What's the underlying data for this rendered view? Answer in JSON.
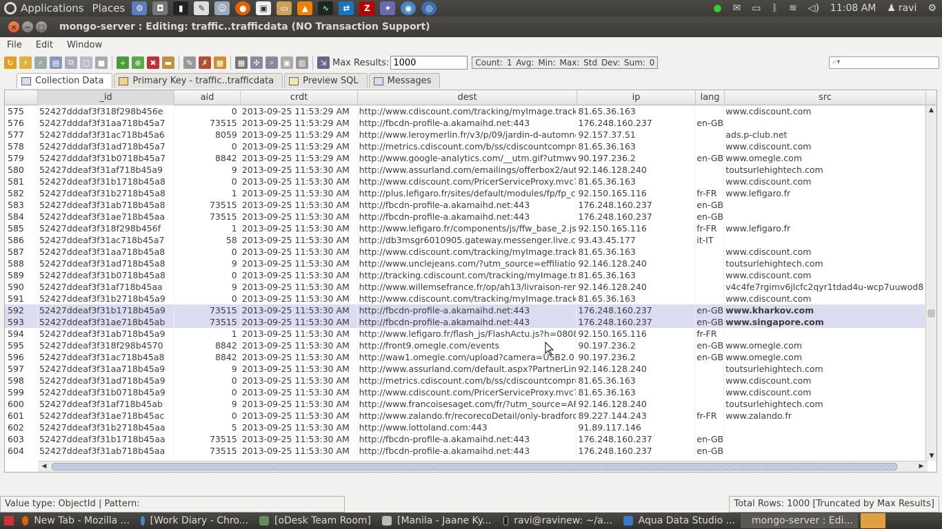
{
  "top_panel": {
    "applications": "Applications",
    "places": "Places",
    "clock": "11:08 AM",
    "user": "ravi"
  },
  "window": {
    "title": "mongo-server : Editing: traffic..trafficdata (NO Transaction Support)"
  },
  "menu": {
    "file": "File",
    "edit": "Edit",
    "window": "Window"
  },
  "toolbar": {
    "max_results_label": "Max Results:",
    "max_results_value": "1000",
    "stats": "Count: 1   Avg:   Min:   Max:   Std Dev:   Sum: 0"
  },
  "tabs": [
    {
      "label": "Collection Data"
    },
    {
      "label": "Primary Key - traffic..trafficdata"
    },
    {
      "label": "Preview SQL"
    },
    {
      "label": "Messages"
    }
  ],
  "grid": {
    "columns": [
      "_id",
      "aid",
      "crdt",
      "dest",
      "ip",
      "lang",
      "src"
    ],
    "rows": [
      {
        "n": "575",
        "id": "52427dddaf3f318f298b456e",
        "aid": "0",
        "crdt": "2013-09-25 11:53:29 AM",
        "dest": "http://www.cdiscount.com/tracking/myImage.track_",
        "ip": "81.65.36.163",
        "lang": "",
        "src": "www.cdiscount.com"
      },
      {
        "n": "576",
        "id": "52427dddaf3f31aa718b45a7",
        "aid": "73515",
        "crdt": "2013-09-25 11:53:29 AM",
        "dest": "http://fbcdn-profile-a.akamaihd.net:443",
        "ip": "176.248.160.237",
        "lang": "en-GB",
        "src": ""
      },
      {
        "n": "577",
        "id": "52427dddaf3f31ac718b45a6",
        "aid": "8059",
        "crdt": "2013-09-25 11:53:29 AM",
        "dest": "http://www.leroymerlin.fr/v3/p/09/jardin-d-automne-",
        "ip": "92.157.37.51",
        "lang": "",
        "src": "ads.p-club.net"
      },
      {
        "n": "578",
        "id": "52427dddaf3f31ad718b45a7",
        "aid": "0",
        "crdt": "2013-09-25 11:53:29 AM",
        "dest": "http://metrics.cdiscount.com/b/ss/cdiscountcompro",
        "ip": "81.65.36.163",
        "lang": "",
        "src": "www.cdiscount.com"
      },
      {
        "n": "579",
        "id": "52427dddaf3f31b0718b45a7",
        "aid": "8842",
        "crdt": "2013-09-25 11:53:29 AM",
        "dest": "http://www.google-analytics.com/__utm.gif?utmwv=",
        "ip": "90.197.236.2",
        "lang": "en-GB",
        "src": "www.omegle.com"
      },
      {
        "n": "580",
        "id": "52427ddeaf3f31af718b45a9",
        "aid": "9",
        "crdt": "2013-09-25 11:53:30 AM",
        "dest": "http://www.assurland.com/emailings/offerbox2/autos",
        "ip": "92.146.128.240",
        "lang": "",
        "src": "toutsurlehightech.com"
      },
      {
        "n": "581",
        "id": "52427ddeaf3f31b1718b45a8",
        "aid": "0",
        "crdt": "2013-09-25 11:53:30 AM",
        "dest": "http://www.cdiscount.com/PricerServiceProxy.mvc?p",
        "ip": "81.65.36.163",
        "lang": "",
        "src": "www.cdiscount.com"
      },
      {
        "n": "582",
        "id": "52427ddeaf3f31b2718b45a8",
        "aid": "1",
        "crdt": "2013-09-25 11:53:30 AM",
        "dest": "http://plus.lefigaro.fr/sites/default/modules/fp/fp_co",
        "ip": "92.150.165.116",
        "lang": "fr-FR",
        "src": "www.lefigaro.fr"
      },
      {
        "n": "583",
        "id": "52427ddeaf3f31ab718b45a8",
        "aid": "73515",
        "crdt": "2013-09-25 11:53:30 AM",
        "dest": "http://fbcdn-profile-a.akamaihd.net:443",
        "ip": "176.248.160.237",
        "lang": "en-GB",
        "src": ""
      },
      {
        "n": "584",
        "id": "52427ddeaf3f31ae718b45aa",
        "aid": "73515",
        "crdt": "2013-09-25 11:53:30 AM",
        "dest": "http://fbcdn-profile-a.akamaihd.net:443",
        "ip": "176.248.160.237",
        "lang": "en-GB",
        "src": ""
      },
      {
        "n": "585",
        "id": "52427ddeaf3f318f298b456f",
        "aid": "1",
        "crdt": "2013-09-25 11:53:30 AM",
        "dest": "http://www.lefigaro.fr/components/js/ffw_base_2.js?",
        "ip": "92.150.165.116",
        "lang": "fr-FR",
        "src": "www.lefigaro.fr"
      },
      {
        "n": "586",
        "id": "52427ddeaf3f31ac718b45a7",
        "aid": "58",
        "crdt": "2013-09-25 11:53:30 AM",
        "dest": "http://db3msgr6010905.gateway.messenger.live.co",
        "ip": "93.43.45.177",
        "lang": "it-IT",
        "src": ""
      },
      {
        "n": "587",
        "id": "52427ddeaf3f31aa718b45a8",
        "aid": "0",
        "crdt": "2013-09-25 11:53:30 AM",
        "dest": "http://www.cdiscount.com/tracking/myImage.track_",
        "ip": "81.65.36.163",
        "lang": "",
        "src": "www.cdiscount.com"
      },
      {
        "n": "588",
        "id": "52427ddeaf3f31ad718b45a8",
        "aid": "9",
        "crdt": "2013-09-25 11:53:30 AM",
        "dest": "http://www.unclejeans.com/?utm_source=effiliation",
        "ip": "92.146.128.240",
        "lang": "",
        "src": "toutsurlehightech.com"
      },
      {
        "n": "589",
        "id": "52427ddeaf3f31b0718b45a8",
        "aid": "0",
        "crdt": "2013-09-25 11:53:30 AM",
        "dest": "http://tracking.cdiscount.com/tracking/myImage.tra",
        "ip": "81.65.36.163",
        "lang": "",
        "src": "www.cdiscount.com"
      },
      {
        "n": "590",
        "id": "52427ddeaf3f31af718b45aa",
        "aid": "9",
        "crdt": "2013-09-25 11:53:30 AM",
        "dest": "http://www.willemsefrance.fr/op/ah13/livraison-remi",
        "ip": "92.146.128.240",
        "lang": "",
        "src": "v4c4fe7rgimv6jlcfc2qyr1tdad4u-wcp7uuwod8"
      },
      {
        "n": "591",
        "id": "52427ddeaf3f31b2718b45a9",
        "aid": "0",
        "crdt": "2013-09-25 11:53:30 AM",
        "dest": "http://www.cdiscount.com/tracking/myImage.track_",
        "ip": "81.65.36.163",
        "lang": "",
        "src": "www.cdiscount.com"
      },
      {
        "n": "592",
        "id": "52427ddeaf3f31b1718b45a9",
        "aid": "73515",
        "crdt": "2013-09-25 11:53:30 AM",
        "dest": "http://fbcdn-profile-a.akamaihd.net:443",
        "ip": "176.248.160.237",
        "lang": "en-GB",
        "src": "www.kharkov.com"
      },
      {
        "n": "593",
        "id": "52427ddeaf3f31ae718b45ab",
        "aid": "73515",
        "crdt": "2013-09-25 11:53:30 AM",
        "dest": "http://fbcdn-profile-a.akamaihd.net:443",
        "ip": "176.248.160.237",
        "lang": "en-GB",
        "src": "www.singapore.com"
      },
      {
        "n": "594",
        "id": "52427ddeaf3f31ab718b45a9",
        "aid": "1",
        "crdt": "2013-09-25 11:53:30 AM",
        "dest": "http://www.lefigaro.fr/flash_js/FlashActu.js?h=0808",
        "ip": "92.150.165.116",
        "lang": "fr-FR",
        "src": ""
      },
      {
        "n": "595",
        "id": "52427ddeaf3f318f298b4570",
        "aid": "8842",
        "crdt": "2013-09-25 11:53:30 AM",
        "dest": "http://front9.omegle.com/events",
        "ip": "90.197.236.2",
        "lang": "en-GB",
        "src": "www.omegle.com"
      },
      {
        "n": "596",
        "id": "52427ddeaf3f31ac718b45a8",
        "aid": "8842",
        "crdt": "2013-09-25 11:53:30 AM",
        "dest": "http://waw1.omegle.com/upload?camera=USB2.0",
        "ip": "90.197.236.2",
        "lang": "en-GB",
        "src": "www.omegle.com"
      },
      {
        "n": "597",
        "id": "52427ddeaf3f31aa718b45a9",
        "aid": "9",
        "crdt": "2013-09-25 11:53:30 AM",
        "dest": "http://www.assurland.com/default.aspx?PartnerLink",
        "ip": "92.146.128.240",
        "lang": "",
        "src": "toutsurlehightech.com"
      },
      {
        "n": "598",
        "id": "52427ddeaf3f31ad718b45a9",
        "aid": "0",
        "crdt": "2013-09-25 11:53:30 AM",
        "dest": "http://metrics.cdiscount.com/b/ss/cdiscountcompro",
        "ip": "81.65.36.163",
        "lang": "",
        "src": "www.cdiscount.com"
      },
      {
        "n": "599",
        "id": "52427ddeaf3f31b0718b45a9",
        "aid": "0",
        "crdt": "2013-09-25 11:53:30 AM",
        "dest": "http://www.cdiscount.com/PricerServiceProxy.mvc?p",
        "ip": "81.65.36.163",
        "lang": "",
        "src": "www.cdiscount.com"
      },
      {
        "n": "600",
        "id": "52427ddeaf3f31af718b45ab",
        "aid": "9",
        "crdt": "2013-09-25 11:53:30 AM",
        "dest": "http://www.francoisesaget.com/fr/?utm_source=AFI",
        "ip": "92.146.128.240",
        "lang": "",
        "src": "toutsurlehightech.com"
      },
      {
        "n": "601",
        "id": "52427ddeaf3f31ae718b45ac",
        "aid": "0",
        "crdt": "2013-09-25 11:53:30 AM",
        "dest": "http://www.zalando.fr/recorecoDetail/only-bradford-",
        "ip": "89.227.144.243",
        "lang": "fr-FR",
        "src": "www.zalando.fr"
      },
      {
        "n": "602",
        "id": "52427ddeaf3f31b2718b45aa",
        "aid": "5",
        "crdt": "2013-09-25 11:53:30 AM",
        "dest": "http://www.lottoland.com:443",
        "ip": "91.89.117.146",
        "lang": "",
        "src": ""
      },
      {
        "n": "603",
        "id": "52427ddeaf3f31b1718b45aa",
        "aid": "73515",
        "crdt": "2013-09-25 11:53:30 AM",
        "dest": "http://fbcdn-profile-a.akamaihd.net:443",
        "ip": "176.248.160.237",
        "lang": "en-GB",
        "src": ""
      },
      {
        "n": "604",
        "id": "52427ddeaf3f31ab718b45aa",
        "aid": "73515",
        "crdt": "2013-09-25 11:53:30 AM",
        "dest": "http://fbcdn-profile-a.akamaihd.net:443",
        "ip": "176.248.160.237",
        "lang": "en-GB",
        "src": ""
      }
    ],
    "selected_rows": [
      "592",
      "593"
    ]
  },
  "status": {
    "left": "Value type: ObjectId | Pattern:",
    "right": "Total Rows: 1000  [Truncated by Max Results]"
  },
  "taskbar": [
    {
      "label": "New Tab - Mozilla ..."
    },
    {
      "label": "[Work Diary - Chro..."
    },
    {
      "label": "[oDesk Team Room]"
    },
    {
      "label": "[Manila - Jaane Ky..."
    },
    {
      "label": "ravi@ravinew: ~/a..."
    },
    {
      "label": "Aqua Data Studio ..."
    },
    {
      "label": "mongo-server : Edi..."
    }
  ],
  "icons": {
    "accent": "#e05a25",
    "selection": "#dcdcf0"
  }
}
